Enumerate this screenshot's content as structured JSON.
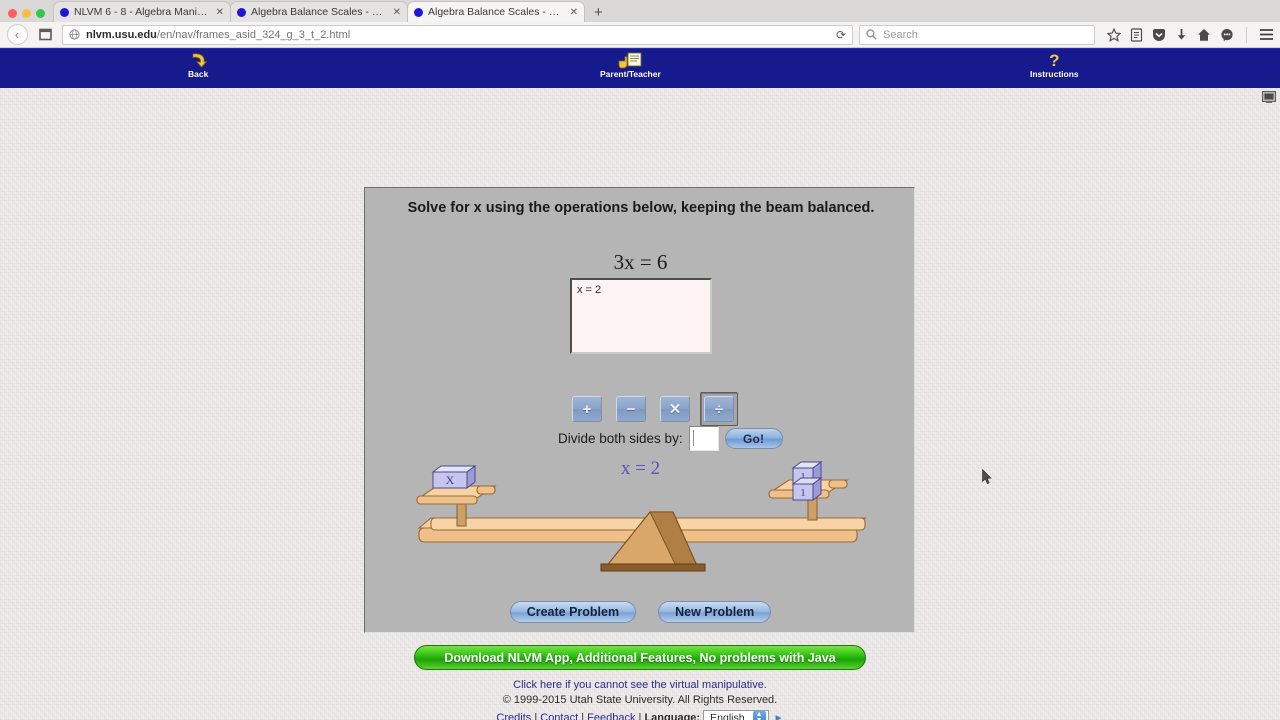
{
  "browser": {
    "tabs": [
      {
        "title": "NLVM 6 - 8 - Algebra Manip...",
        "close": "✕",
        "active": false
      },
      {
        "title": "Algebra Balance Scales - N...",
        "close": "✕",
        "active": false
      },
      {
        "title": "Algebra Balance Scales - N...",
        "close": "✕",
        "active": true
      }
    ],
    "new_tab_label": "+",
    "back_glyph": "‹",
    "reload_glyph": "⟳",
    "url": {
      "host": "nlvm.usu.edu",
      "path": "/en/nav/frames_asid_324_g_3_t_2.html"
    },
    "search_placeholder": "Search",
    "toolbar_icons": [
      "star-icon",
      "reader-icon",
      "pocket-icon",
      "downloads-icon",
      "home-icon",
      "chat-icon",
      "menu-icon"
    ]
  },
  "appbar": {
    "back": {
      "label": "Back",
      "icon": "back-arrow-icon"
    },
    "parent_teacher": {
      "label": "Parent/Teacher",
      "icon": "hand-board-icon"
    },
    "instructions": {
      "label": "Instructions",
      "icon": "question-mark-icon"
    }
  },
  "applet": {
    "prompt": "Solve for x using the operations below, keeping the beam balanced.",
    "equation": "3x = 6",
    "work_text": "x = 2",
    "operations": [
      {
        "name": "plus",
        "glyph": "+",
        "selected": false
      },
      {
        "name": "minus",
        "glyph": "−",
        "selected": false
      },
      {
        "name": "times",
        "glyph": "✕",
        "selected": false
      },
      {
        "name": "divide",
        "glyph": "÷",
        "selected": true
      }
    ],
    "operand_label": "Divide both sides by:",
    "operand_value": "",
    "go_label": "Go!",
    "solution": "x = 2",
    "create_problem_label": "Create Problem",
    "new_problem_label": "New Problem",
    "scale": {
      "left_blocks": [
        {
          "label": "X"
        }
      ],
      "right_blocks": [
        {
          "label": "1"
        },
        {
          "label": "1"
        }
      ]
    }
  },
  "footer": {
    "download_banner": "Download NLVM App, Additional Features, No problems with Java",
    "note": "Click here if you cannot see the virtual manipulative.",
    "copyright": "© 1999-2015 Utah State University. All Rights Reserved.",
    "links": [
      "Credits",
      "Contact",
      "Feedback"
    ],
    "sep": "|",
    "language_label": "Language:",
    "language_value": "English"
  },
  "colors": {
    "appbar": "#161a8c",
    "applet_bg": "#b5b5b5",
    "solution": "#5a4fc4",
    "download": "#32c211"
  }
}
